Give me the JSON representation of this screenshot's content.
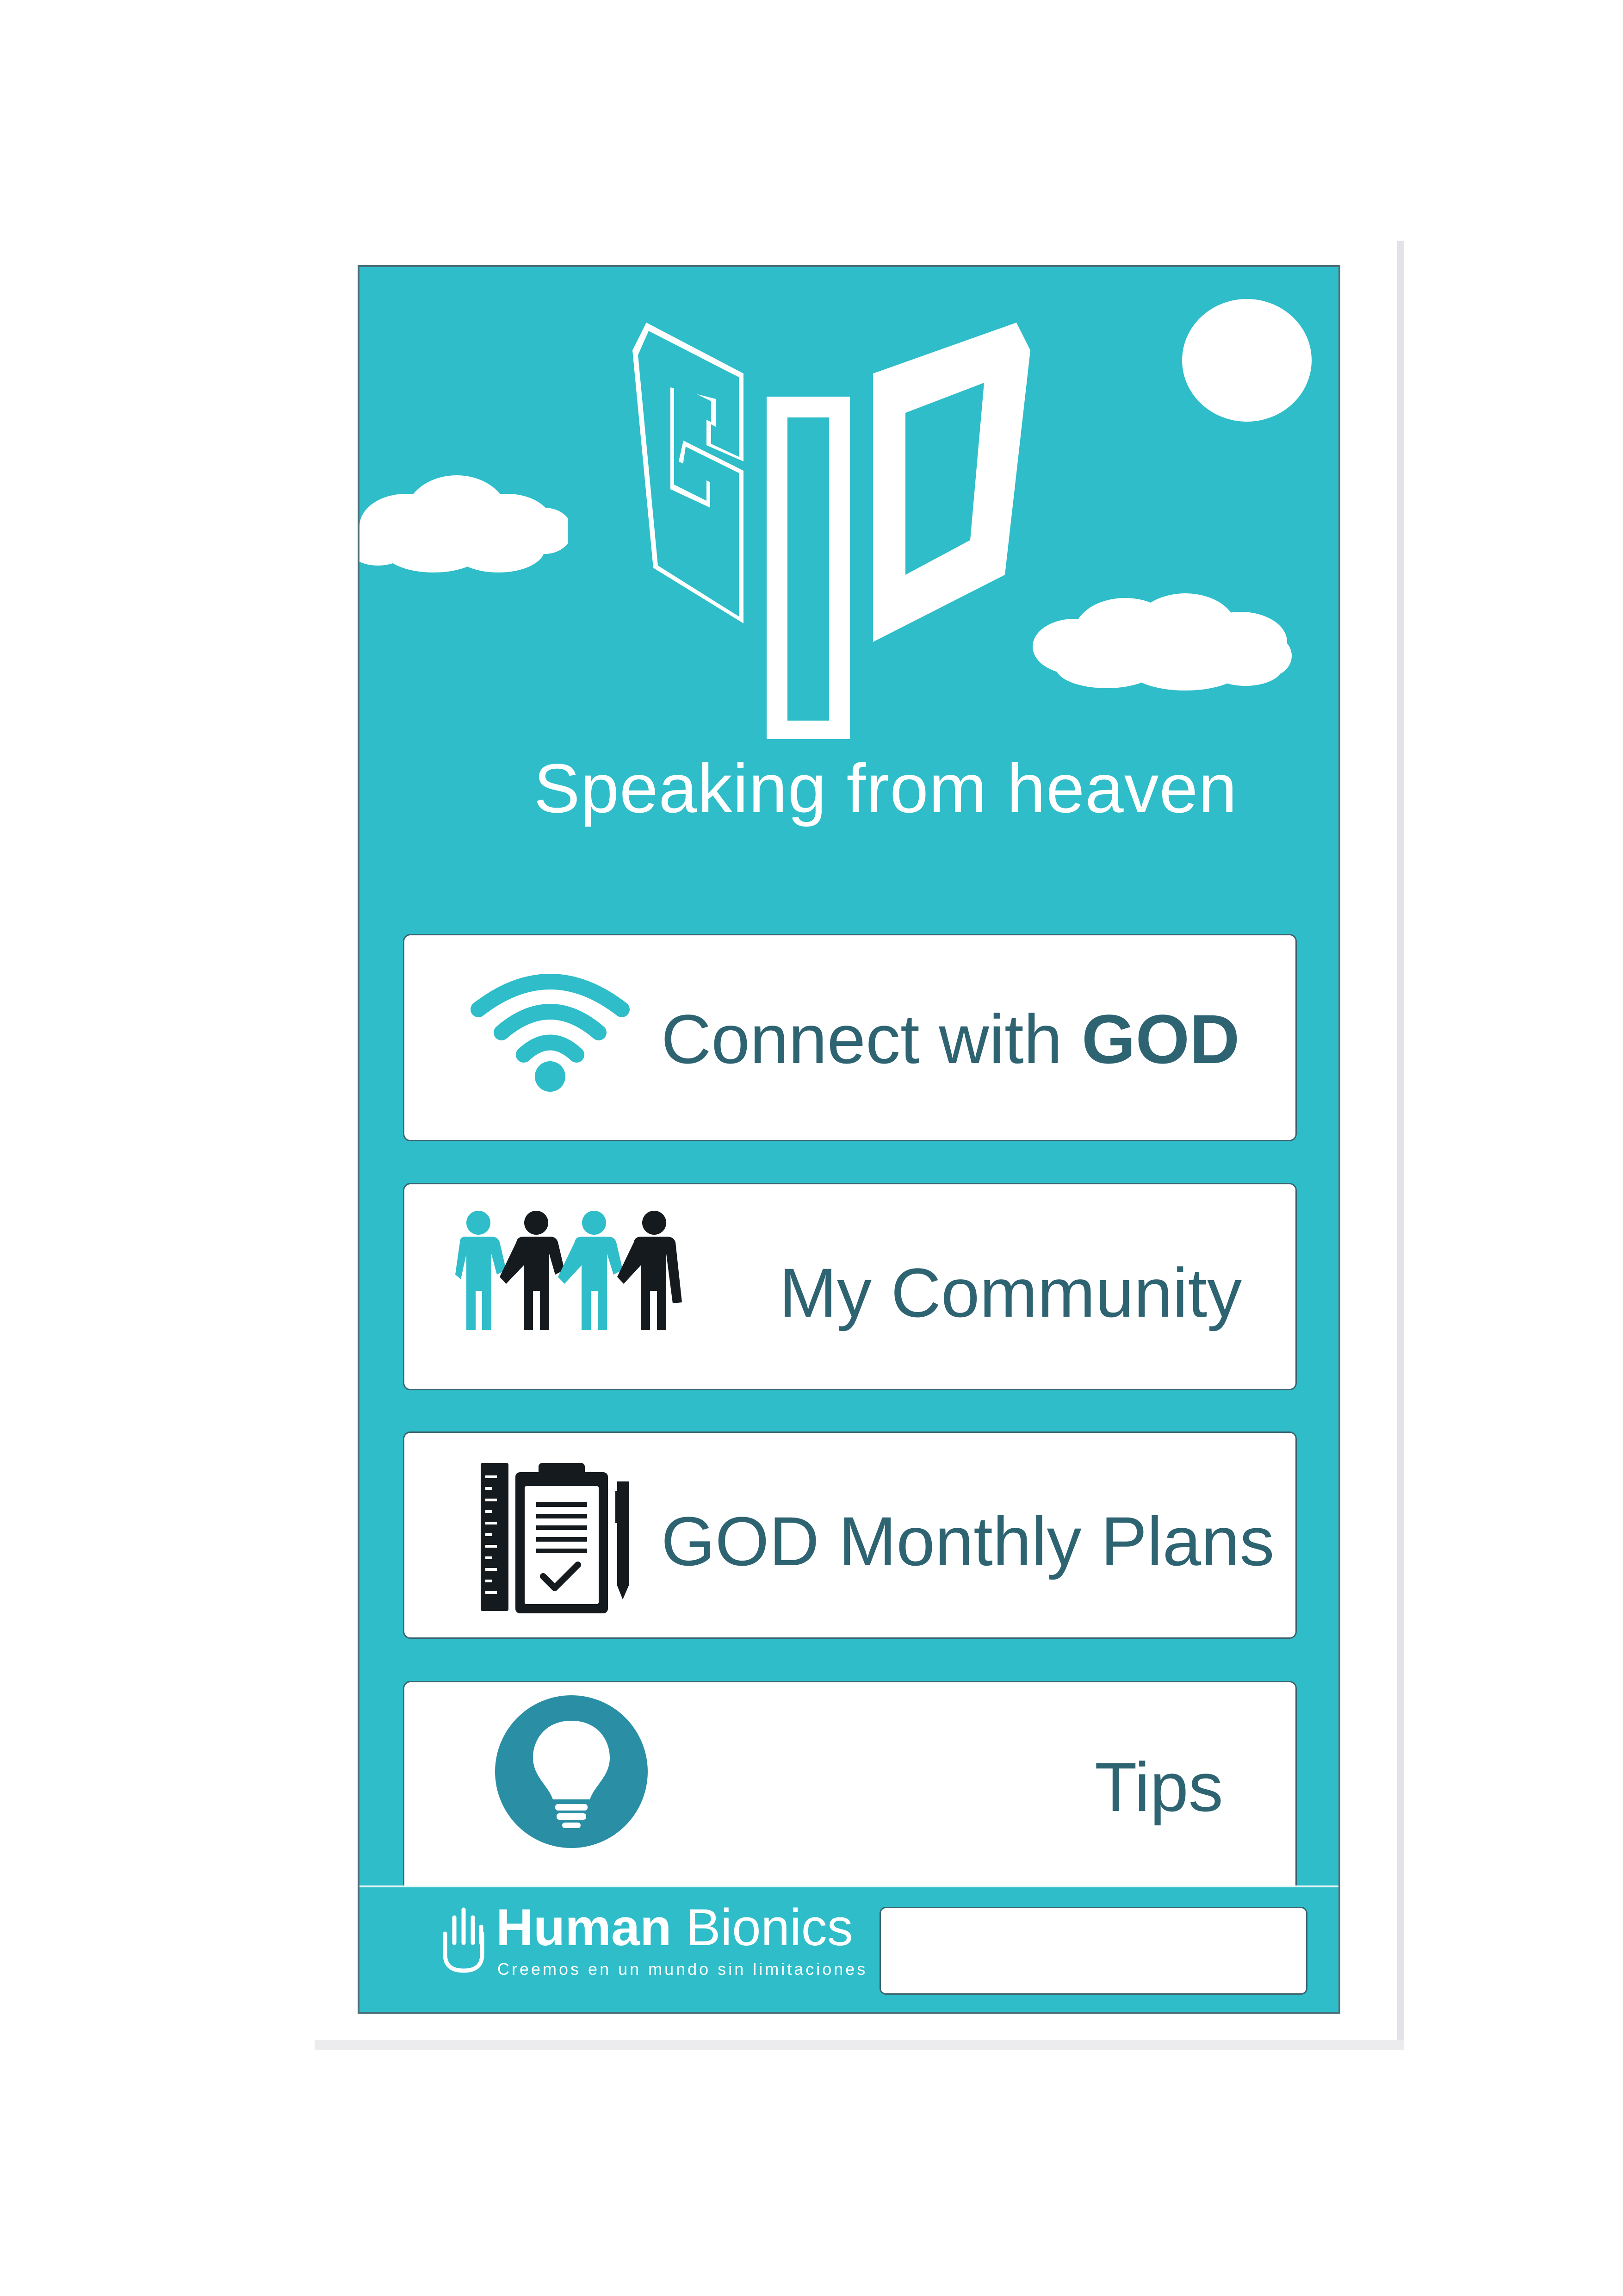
{
  "app": {
    "logo_text": "GOD",
    "tagline": "Speaking from heaven"
  },
  "menu": [
    {
      "label_prefix": "Connect with ",
      "label_bold": "GOD",
      "icon": "wifi-icon"
    },
    {
      "label": "My Community",
      "icon": "community-people-icon"
    },
    {
      "label": "GOD Monthly Plans",
      "icon": "clipboard-plan-icon"
    },
    {
      "label": "Tips",
      "icon": "lightbulb-icon"
    }
  ],
  "footer": {
    "brand_bold": "Human",
    "brand_light": " Bionics",
    "slogan": "Creemos en un mundo sin limitaciones",
    "field_value": ""
  },
  "colors": {
    "background": "#2ebdc9",
    "text_dark": "#2e6472",
    "icon_teal": "#2ebdc9",
    "icon_dark": "#151a1e",
    "bulb_circle": "#2a8fa5"
  }
}
